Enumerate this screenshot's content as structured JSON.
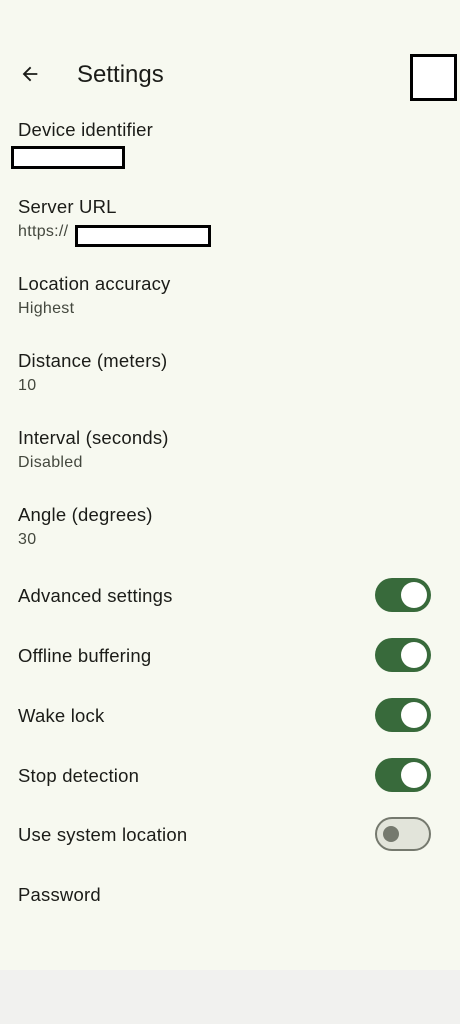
{
  "app_bar": {
    "title": "Settings",
    "back_icon": "arrow-left-icon"
  },
  "preferences": [
    {
      "label": "Device identifier",
      "summary": ""
    },
    {
      "label": "Server URL",
      "summary": "https://"
    },
    {
      "label": "Location accuracy",
      "summary": "Highest"
    },
    {
      "label": "Distance (meters)",
      "summary": "10"
    },
    {
      "label": "Interval (seconds)",
      "summary": "Disabled"
    },
    {
      "label": "Angle (degrees)",
      "summary": "30"
    }
  ],
  "switches": [
    {
      "label": "Advanced settings",
      "checked": true
    },
    {
      "label": "Offline buffering",
      "checked": true
    },
    {
      "label": "Wake lock",
      "checked": true
    },
    {
      "label": "Stop detection",
      "checked": true
    },
    {
      "label": "Use system location",
      "checked": false
    }
  ],
  "password": {
    "label": "Password"
  },
  "colors": {
    "accent": "#386a3b",
    "background": "#f7f9f0",
    "switch_off_track": "#e2e4da",
    "switch_off_border": "#75796e"
  }
}
